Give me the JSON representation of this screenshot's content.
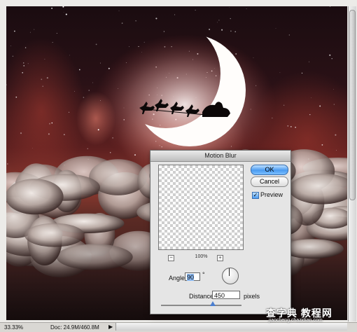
{
  "dialog": {
    "title": "Motion Blur",
    "ok_label": "OK",
    "cancel_label": "Cancel",
    "preview_label": "Preview",
    "preview_checked": true,
    "zoom_out_label": "−",
    "zoom_in_label": "+",
    "zoom_level": "100%",
    "angle_label": "Angle:",
    "angle_value": "90",
    "angle_unit": "°",
    "distance_label": "Distance:",
    "distance_value": "450",
    "distance_unit": "pixels"
  },
  "status_bar": {
    "zoom": "33.33%",
    "doc_size": "Doc: 24.9M/460.8M",
    "menu_arrow": "▶"
  },
  "watermark": {
    "title": "查字典 教程网",
    "url": "jiaocheng.chazidian.com"
  },
  "colors": {
    "ok_accent": "#4b9bf0",
    "sky_top": "#1a0c10",
    "horizon_glow": "#8d3a30"
  },
  "icons": {
    "angle_dial": "angle-dial-icon",
    "sleigh": "santa-sleigh-silhouette",
    "moon": "crescent-moon"
  }
}
